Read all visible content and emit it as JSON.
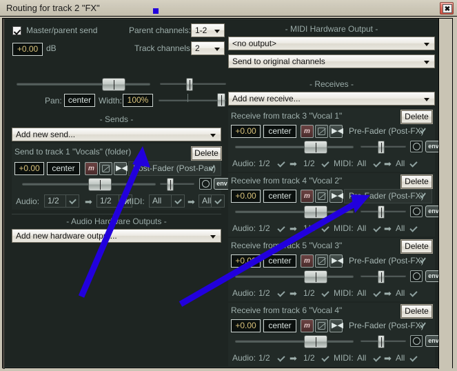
{
  "window": {
    "title": "Routing for track 2 \"FX\"",
    "close_label": "✖"
  },
  "master": {
    "checkbox_label": "Master/parent send",
    "gain_value": "+0.00",
    "db_label": "dB",
    "parent_channels_label": "Parent channels:",
    "parent_channels_value": "1-2",
    "track_channels_label": "Track channels:",
    "track_channels_value": "2",
    "pan_label": "Pan:",
    "pan_value": "center",
    "width_label": "Width:",
    "width_value": "100%"
  },
  "sends": {
    "section_title": "-  Sends  -",
    "add_new": "Add new send...",
    "items": [
      {
        "title": "Send to track 1 \"Vocals\" (folder)",
        "delete_label": "Delete",
        "gain": "+0.00",
        "pan": "center",
        "mute_label": "m",
        "mode": "Post-Fader (Post-Pan)",
        "env_label": "env",
        "audio_label": "Audio:",
        "audio_src": "1/2",
        "audio_dst": "1/2",
        "midi_label": "MIDI:",
        "midi_src": "All",
        "midi_dst": "All"
      }
    ]
  },
  "audio_hw": {
    "section_title": "-  Audio Hardware Outputs  -",
    "add_new": "Add new hardware output..."
  },
  "midi_hw": {
    "section_title": "-  MIDI Hardware Output  -",
    "output_value": "<no output>",
    "channels_value": "Send to original channels"
  },
  "receives": {
    "section_title": "-  Receives  -",
    "add_new": "Add new receive...",
    "items": [
      {
        "title": "Receive from track 3 \"Vocal 1\"",
        "delete_label": "Delete",
        "gain": "+0.00",
        "pan": "center",
        "mute_label": "m",
        "mode": "Pre-Fader (Post-FX)",
        "env_label": "env",
        "audio_label": "Audio:",
        "audio_src": "1/2",
        "audio_dst": "1/2",
        "midi_label": "MIDI:",
        "midi_src": "All",
        "midi_dst": "All"
      },
      {
        "title": "Receive from track 4 \"Vocal 2\"",
        "delete_label": "Delete",
        "gain": "+0.00",
        "pan": "center",
        "mute_label": "m",
        "mode": "Pre-Fader (Post-FX)",
        "env_label": "env",
        "audio_label": "Audio:",
        "audio_src": "1/2",
        "audio_dst": "1/2",
        "midi_label": "MIDI:",
        "midi_src": "All",
        "midi_dst": "All"
      },
      {
        "title": "Receive from track 5 \"Vocal 3\"",
        "delete_label": "Delete",
        "gain": "+0.00",
        "pan": "center",
        "mute_label": "m",
        "mode": "Pre-Fader (Post-FX)",
        "env_label": "env",
        "audio_label": "Audio:",
        "audio_src": "1/2",
        "audio_dst": "1/2",
        "midi_label": "MIDI:",
        "midi_src": "All",
        "midi_dst": "All"
      },
      {
        "title": "Receive from track 6 \"Vocal 4\"",
        "delete_label": "Delete",
        "gain": "+0.00",
        "pan": "center",
        "mute_label": "m",
        "mode": "Pre-Fader (Post-FX)",
        "env_label": "env",
        "audio_label": "Audio:",
        "audio_src": "1/2",
        "audio_dst": "1/2",
        "midi_label": "MIDI:",
        "midi_src": "All",
        "midi_dst": "All"
      }
    ]
  },
  "colors": {
    "panel_bg": "#1e2522",
    "block_bg": "#222a27",
    "text": "#9fb0ad",
    "annotation": "#2200dd",
    "titlebar": "#cdc8b8"
  }
}
